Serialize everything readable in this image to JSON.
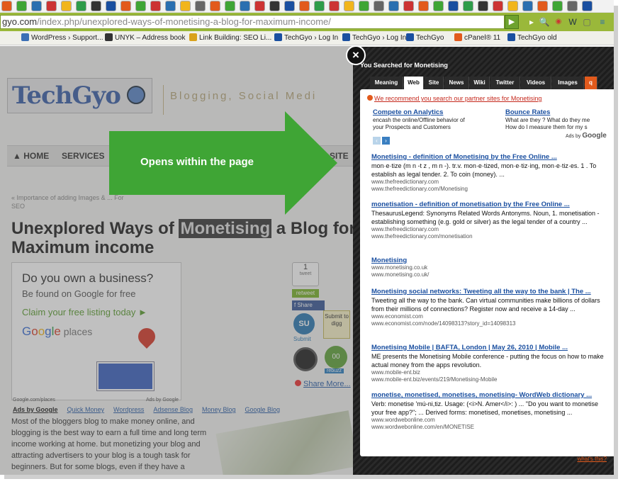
{
  "browser": {
    "url_prefix": "gyo.com",
    "url_path": "/index.php/unexplored-ways-of-monetising-a-blog-for-maximum-income/",
    "go_label": "▶",
    "bookmarks": [
      "WordPress › Support...",
      "UNYK – Address book",
      "Link Building: SEO Li...",
      "TechGyo › Log In",
      "TechGyo › Log In",
      "TechGyo",
      "cPanel® 11",
      "TechGyo old"
    ]
  },
  "site": {
    "tagline": "Blogging, Social Medi",
    "nav": [
      "HOME",
      "SERVICES",
      "SITE"
    ],
    "breadcrumb": "« Importance of adding Images & ... For SEO",
    "title_before": "Unexplored Ways of ",
    "title_highlight": "Monetising",
    "title_after": " a Blog for Maximum income",
    "ad": {
      "headline": "Do you own a business?",
      "sub": "Be found on Google for free",
      "cta": "Claim your free listing today ►",
      "brand": "Google places",
      "foot_left": "Google.com/places",
      "foot_right": "Ads by Google"
    },
    "share": {
      "tweet_count": "1",
      "tweet_label": "tweet",
      "retweet": "retweet",
      "fb_share": "Share",
      "stumble_label": "Submit",
      "digg_label": "Submit to digg",
      "buzz_count": "00",
      "rebuzz": "rebuzz",
      "share_more": "Share More..."
    },
    "ad_links": [
      "Ads by Google",
      "Quick Money",
      "Wordpress",
      "Adsense Blog",
      "Money Blog",
      "Google Blog"
    ],
    "body_text": "Most of the bloggers blog to make money online, and blogging is the best way to earn a full time and long term income working at home. but monetizing your blog and attracting advertisers to your blog is a tough task for beginners. But for some blogs, even if they have a"
  },
  "callout": {
    "text": "Opens within the page"
  },
  "overlay": {
    "close_label": "×",
    "heading": "You Searched for Monetising",
    "tabs": [
      "Meaning",
      "Web",
      "Site",
      "News",
      "Wiki",
      "Twitter",
      "Videos",
      "Images",
      "q"
    ],
    "active_tab": "Web",
    "recommend": "We recommend you search our partner sites for Monetising",
    "sponsored": [
      {
        "title": "Compete on Analytics",
        "line1": "encash the online/Offline behavior of",
        "line2": "your Prospects and Customers"
      },
      {
        "title": "Bounce Rates",
        "line1": "What are they ? What do they me",
        "line2": "How do I measure them for my s"
      }
    ],
    "ads_by": "Ads by",
    "ads_by_brand": "Google",
    "results": [
      {
        "title": "Monetising - definition of Monetising by the Free Online ...",
        "desc": "mon·e·tize (m n -t z , m n -). tr.v. mon·e·tized, mon·e·tiz·ing, mon·e·tiz·es. 1 . To establish as legal tender. 2. To coin (money). ...",
        "url1": "www.thefreedictionary.com",
        "url2": "www.thefreedictionary.com/Monetising"
      },
      {
        "title": "monetisation - definition of monetisation by the Free Online ...",
        "desc": "ThesaurusLegend: Synonyms Related Words Antonyms. Noun, 1. monetisation - establishing something (e.g. gold or silver) as the legal tender of a country ...",
        "url1": "www.thefreedictionary.com",
        "url2": "www.thefreedictionary.com/monetisation"
      },
      {
        "title": "Monetising",
        "desc": "",
        "url1": "www.monetising.co.uk",
        "url2": "www.monetising.co.uk/"
      },
      {
        "title": "Monetising social networks: Tweeting all the way to the bank | The ...",
        "desc": "Tweeting all the way to the bank. Can virtual communities make billions of dollars from their millions of connections? Register now and receive a 14-day ...",
        "url1": "www.economist.com",
        "url2": "www.economist.com/node/14098313?story_id=14098313"
      },
      {
        "title": "Monetising Mobile | BAFTA, London | May 26, 2010 | Mobile ...",
        "desc": "ME presents the Monetising Mobile conference - putting the focus on how to make actual money from the apps revolution.",
        "url1": "www.mobile-ent.biz",
        "url2": "www.mobile-ent.biz/events/219/Monetising-Mobile"
      },
      {
        "title": "monetise, monetised, monetises, monetising- WordWeb dictionary ...",
        "desc": "Verb: monetise 'mú-ni,tiz. Usage: (<i>N. Amer</i>: ) ... \"Do you want to monetise your free app?\"; ... Derived forms: monetised, monetises, monetising ...",
        "url1": "www.wordwebonline.com",
        "url2": "www.wordwebonline.com/en/MONETISE"
      }
    ],
    "whats_this": "what's this?"
  },
  "colors": {
    "accent_green": "#3fa535",
    "overlay_bg": "#1d1d1d",
    "link_blue": "#1a4fa0",
    "brand_orange": "#e25a1c"
  }
}
